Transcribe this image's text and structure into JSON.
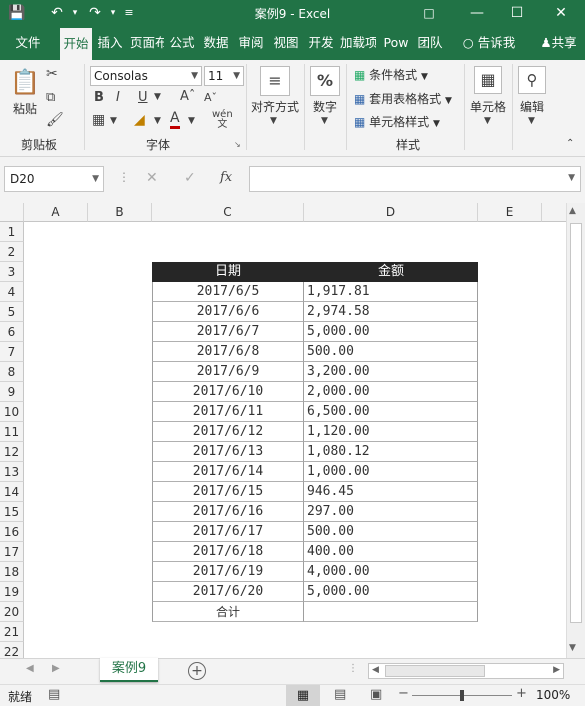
{
  "window": {
    "title": "案例9  -  Excel"
  },
  "tabs": [
    "文件",
    "开始",
    "插入",
    "页面布",
    "公式",
    "数据",
    "审阅",
    "视图",
    "开发",
    "加载项",
    "Pow",
    "团队"
  ],
  "tell_me": "告诉我",
  "share": "共享",
  "ribbon": {
    "clipboard": {
      "paste": "粘贴",
      "label": "剪贴板"
    },
    "font": {
      "name": "Consolas",
      "size": "11",
      "label": "字体",
      "bold": "B",
      "italic": "I",
      "underline": "U",
      "phonetic": "wén"
    },
    "alignment": {
      "label": "对齐方式"
    },
    "number": {
      "label": "数字",
      "symbol": "%"
    },
    "styles": {
      "conditional": "条件格式",
      "table": "套用表格格式",
      "cell": "单元格样式",
      "label": "样式"
    },
    "cells": {
      "label": "单元格"
    },
    "editing": {
      "label": "编辑"
    }
  },
  "formula_bar": {
    "name_box": "D20",
    "fx": "fx",
    "value": ""
  },
  "columns": [
    "A",
    "B",
    "C",
    "D",
    "E"
  ],
  "rows": [
    "1",
    "2",
    "3",
    "4",
    "5",
    "6",
    "7",
    "8",
    "9",
    "10",
    "11",
    "12",
    "13",
    "14",
    "15",
    "16",
    "17",
    "18",
    "19",
    "20",
    "21",
    "22"
  ],
  "table": {
    "headers": [
      "日期",
      "金额"
    ],
    "data": [
      [
        "2017/6/5",
        "1,917.81"
      ],
      [
        "2017/6/6",
        "2,974.58"
      ],
      [
        "2017/6/7",
        "5,000.00"
      ],
      [
        "2017/6/8",
        "500.00"
      ],
      [
        "2017/6/9",
        "3,200.00"
      ],
      [
        "2017/6/10",
        "2,000.00"
      ],
      [
        "2017/6/11",
        "6,500.00"
      ],
      [
        "2017/6/12",
        "1,120.00"
      ],
      [
        "2017/6/13",
        "1,080.12"
      ],
      [
        "2017/6/14",
        "1,000.00"
      ],
      [
        "2017/6/15",
        "946.45"
      ],
      [
        "2017/6/16",
        "297.00"
      ],
      [
        "2017/6/17",
        "500.00"
      ],
      [
        "2017/6/18",
        "400.00"
      ],
      [
        "2017/6/19",
        "4,000.00"
      ],
      [
        "2017/6/20",
        "5,000.00"
      ]
    ],
    "total_label": "合计",
    "total_value": ""
  },
  "sheet_tabs": [
    "案例9"
  ],
  "status": {
    "ready": "就绪",
    "zoom": "100%"
  },
  "colors": {
    "accent": "#217346",
    "header_bg": "#262626"
  }
}
